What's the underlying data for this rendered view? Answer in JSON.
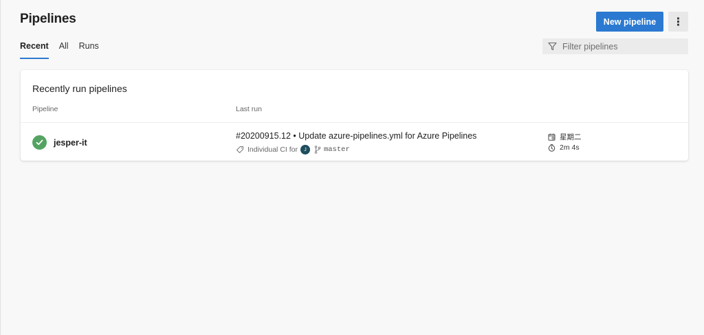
{
  "header": {
    "title": "Pipelines",
    "new_button_label": "New pipeline",
    "more_label": "⋮"
  },
  "tabs": [
    {
      "label": "Recent",
      "active": true
    },
    {
      "label": "All",
      "active": false
    },
    {
      "label": "Runs",
      "active": false
    }
  ],
  "filter": {
    "placeholder": "Filter pipelines"
  },
  "card": {
    "title": "Recently run pipelines",
    "columns": {
      "pipeline": "Pipeline",
      "last_run": "Last run"
    },
    "rows": [
      {
        "status": "succeeded",
        "name": "jesper-it",
        "run_title": "#20200915.12 • Update azure-pipelines.yml for Azure Pipelines",
        "trigger": "Individual CI for",
        "avatar_initial": "J",
        "branch": "master",
        "when": "星期二",
        "duration": "2m 4s"
      }
    ]
  },
  "colors": {
    "accent": "#2b79d1",
    "success": "#55a362",
    "avatar": "#1e4e5e"
  },
  "icons": [
    "filter-icon",
    "more-vertical-icon",
    "check-circle-icon",
    "tag-icon",
    "branch-icon",
    "calendar-icon",
    "clock-icon"
  ]
}
